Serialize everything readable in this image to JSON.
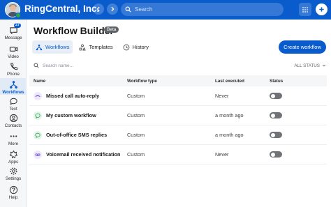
{
  "topbar": {
    "company": "RingCentral, Inc.",
    "search_placeholder": "Search",
    "icons": [
      "back-icon",
      "forward-icon",
      "search-icon",
      "dialpad-icon",
      "plus-icon"
    ]
  },
  "sidebar": {
    "items": [
      {
        "label": "Message",
        "icon": "message-icon",
        "badge": "27"
      },
      {
        "label": "Video",
        "icon": "video-icon"
      },
      {
        "label": "Phone",
        "icon": "phone-icon"
      },
      {
        "label": "Workflows",
        "icon": "workflow-icon",
        "active": true
      },
      {
        "label": "Text",
        "icon": "text-icon"
      },
      {
        "label": "Contacts",
        "icon": "contacts-icon"
      },
      {
        "label": "More",
        "icon": "more-icon"
      },
      {
        "label": "Apps",
        "icon": "apps-icon"
      },
      {
        "label": "Settings",
        "icon": "settings-icon"
      },
      {
        "label": "Help",
        "icon": "help-icon"
      }
    ]
  },
  "page": {
    "title": "Workflow Builder",
    "badge": "Beta",
    "tabs": [
      {
        "label": "Workflows",
        "icon": "workflow-icon",
        "active": true
      },
      {
        "label": "Templates",
        "icon": "templates-icon"
      },
      {
        "label": "History",
        "icon": "history-icon"
      }
    ],
    "create_label": "Create workflow",
    "search_placeholder": "Search name...",
    "status_filter": "ALL STATUS"
  },
  "table": {
    "headers": {
      "name": "Name",
      "type": "Workflow type",
      "last": "Last executed",
      "status": "Status"
    },
    "rows": [
      {
        "name": "Missed call auto-reply",
        "type": "Custom",
        "last": "Never",
        "icon": "missed-call-icon",
        "icon_color": "#7a5cc8",
        "icon_bg": "#efe9fb",
        "enabled": false
      },
      {
        "name": "My custom workflow",
        "type": "Custom",
        "last": "a month ago",
        "icon": "sms-icon",
        "icon_color": "#2e9b4f",
        "icon_bg": "#e3f4e8",
        "enabled": false
      },
      {
        "name": "Out-of-office SMS replies",
        "type": "Custom",
        "last": "a month ago",
        "icon": "sms-icon",
        "icon_color": "#2e9b4f",
        "icon_bg": "#e3f4e8",
        "enabled": false
      },
      {
        "name": "Voicemail received notification",
        "type": "Custom",
        "last": "Never",
        "icon": "voicemail-icon",
        "icon_color": "#7a5cc8",
        "icon_bg": "#efe9fb",
        "enabled": false
      }
    ]
  },
  "colors": {
    "brand": "#0a5bcc",
    "toggle_off": "#6f7378",
    "presence": "#29a744"
  }
}
